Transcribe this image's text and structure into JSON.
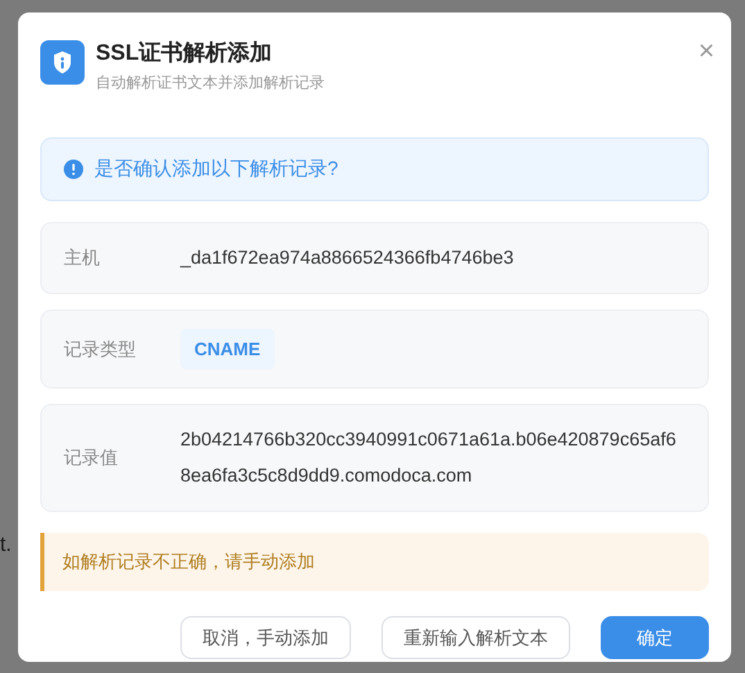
{
  "background_text": [
    "t."
  ],
  "dialog": {
    "title": "SSL证书解析添加",
    "subtitle": "自动解析证书文本并添加解析记录",
    "close": "×",
    "confirm_prompt": "是否确认添加以下解析记录?",
    "fields": [
      {
        "label": "主机",
        "kind": "text",
        "value": "_da1f672ea974a8866524366fb4746be3"
      },
      {
        "label": "记录类型",
        "kind": "tag",
        "value": "CNAME"
      },
      {
        "label": "记录值",
        "kind": "text",
        "value": "2b04214766b320cc3940991c0671a61a.b06e420879c65af68ea6fa3c5c8d9dd9.comodoca.com"
      }
    ],
    "warning": "如解析记录不正确，请手动添加",
    "buttons": [
      {
        "label": "取消，手动添加",
        "kind": "default"
      },
      {
        "label": "重新输入解析文本",
        "kind": "default"
      },
      {
        "label": "确定",
        "kind": "primary"
      }
    ]
  }
}
